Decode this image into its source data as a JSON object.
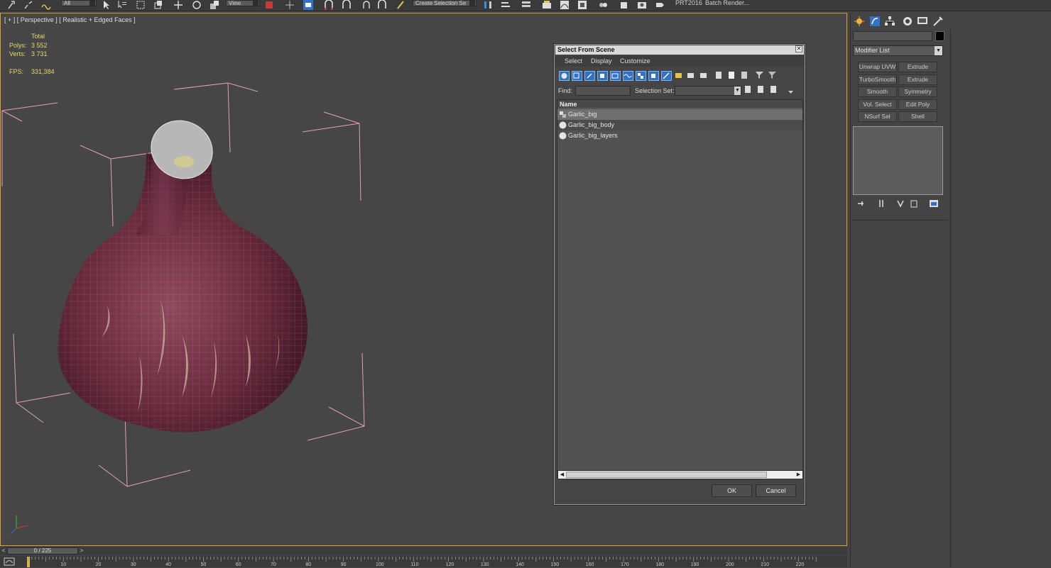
{
  "toolbar": {
    "dropdown_filter": "All",
    "dropdown_ref": "View",
    "dropdown_selset": "Create Selection Se",
    "label_prt": "PRT2016",
    "label_batch": "Batch Render..."
  },
  "viewport": {
    "label": "[ + ] [ Perspective ] [ Realistic + Edged Faces ]",
    "stats": {
      "header": "Total",
      "polys_label": "Polys:",
      "polys_value": "3 552",
      "verts_label": "Verts:",
      "verts_value": "3 731",
      "fps_label": "FPS:",
      "fps_value": "331,384"
    }
  },
  "dialog": {
    "title": "Select From Scene",
    "close_glyph": "✕",
    "menu": [
      "Select",
      "Display",
      "Customize"
    ],
    "find_label": "Find:",
    "find_value": "",
    "selset_label": "Selection Set:",
    "selset_value": "",
    "column_header": "Name",
    "items": [
      {
        "name": "Garlic_big",
        "icon": "group-icon"
      },
      {
        "name": "Garlic_big_body",
        "icon": "geometry-sphere-icon"
      },
      {
        "name": "Garlic_big_layers",
        "icon": "geometry-sphere-icon"
      }
    ],
    "ok_label": "OK",
    "cancel_label": "Cancel"
  },
  "command_panel": {
    "modifier_list_label": "Modifier List",
    "buttons": [
      [
        "Unwrap UVW",
        "Extrude"
      ],
      [
        "TurboSmooth",
        "Extrude"
      ],
      [
        "Smooth",
        "Symmetry"
      ],
      [
        "Vol. Select",
        "Edit Poly"
      ],
      [
        "NSurf Sel",
        "Shell"
      ]
    ]
  },
  "timeline": {
    "frame_display": "0 / 225",
    "prev_glyph": "<",
    "next_glyph": ">",
    "ticks": [
      "10",
      "20",
      "30",
      "40",
      "50",
      "60",
      "70",
      "80",
      "90",
      "100",
      "110",
      "120",
      "130",
      "140",
      "150",
      "160",
      "170",
      "180",
      "190",
      "200",
      "210",
      "220"
    ]
  },
  "colors": {
    "viewport_border": "#d9a22c",
    "stats_text": "#e8d86a",
    "bounding_box": "#e7a1b6",
    "garlic_skin": "#6e2a3e"
  }
}
